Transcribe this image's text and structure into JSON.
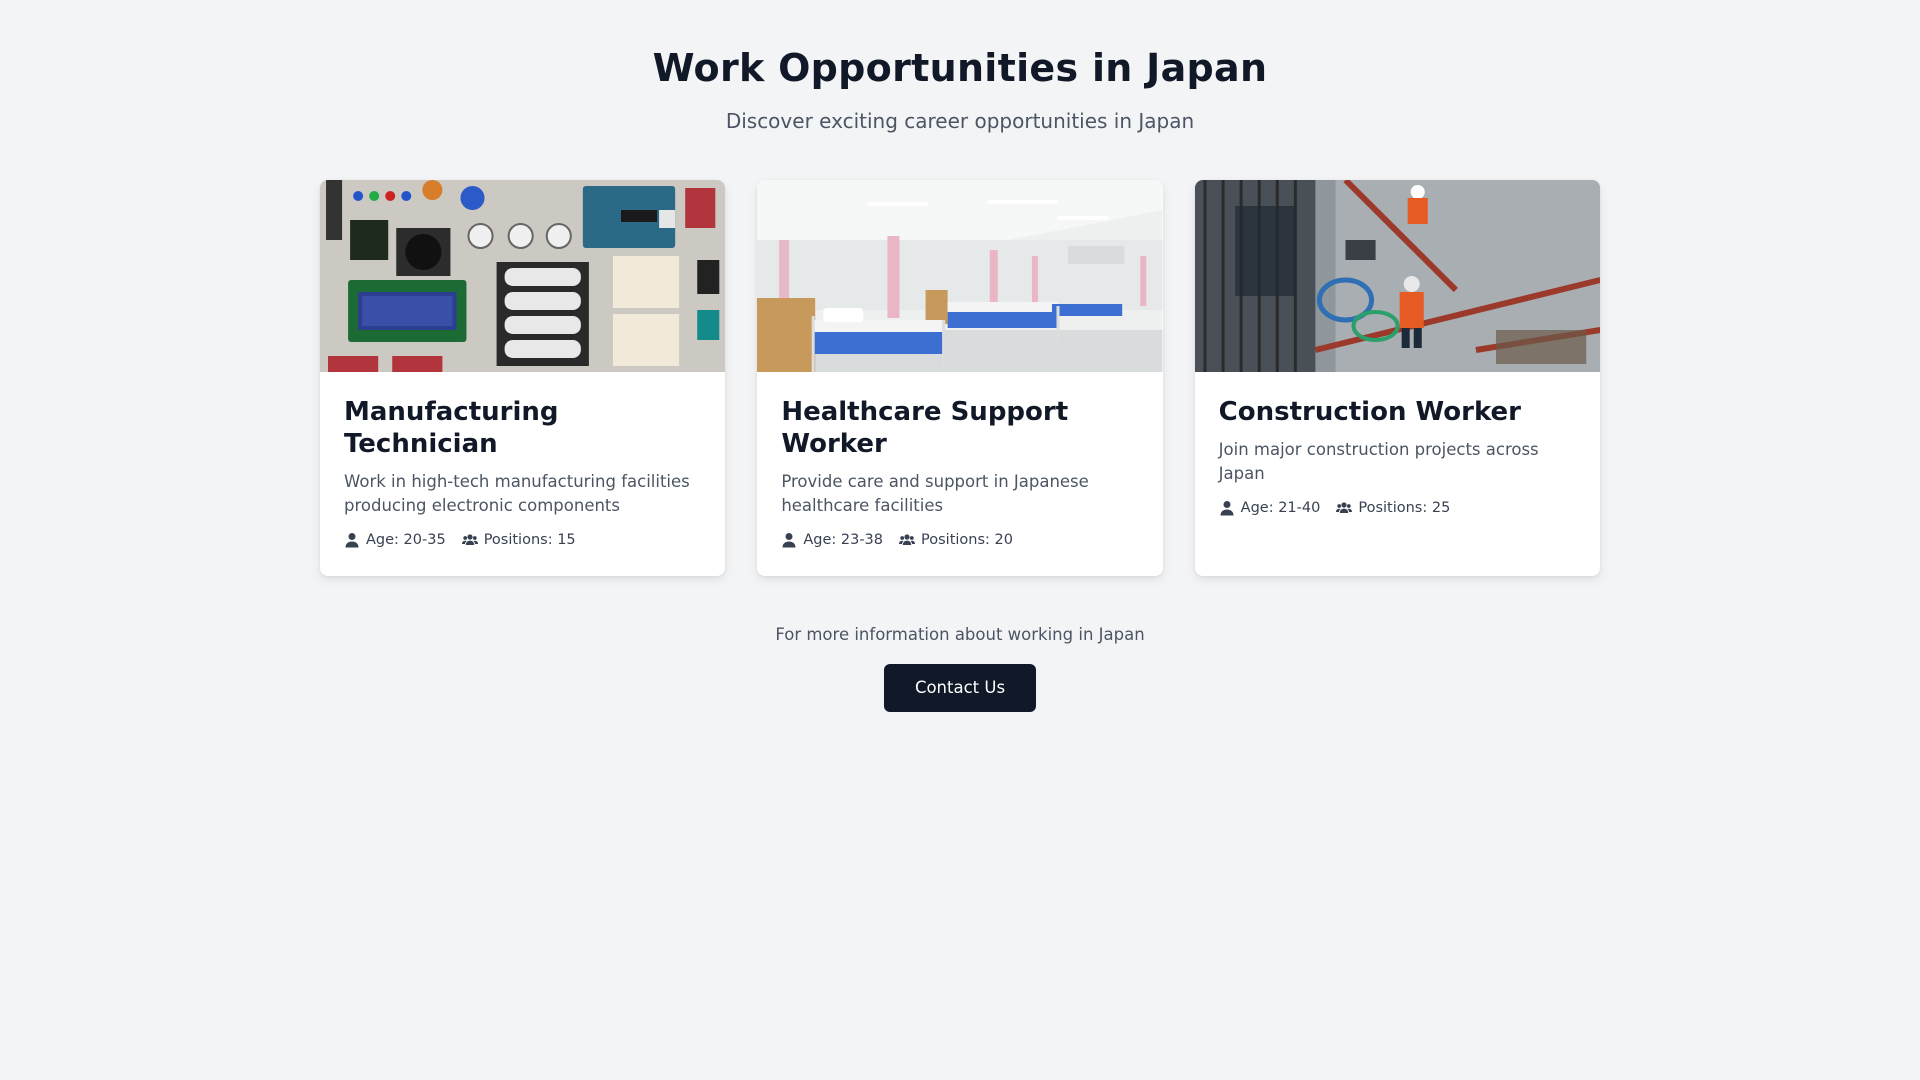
{
  "header": {
    "title": "Work Opportunities in Japan",
    "subtitle": "Discover exciting career opportunities in Japan"
  },
  "jobs": [
    {
      "title": "Manufacturing Technician",
      "description": "Work in high-tech manufacturing facilities producing electronic components",
      "age": "Age: 20-35",
      "positions": "Positions: 15",
      "image": "electronics-components-photo"
    },
    {
      "title": "Healthcare Support Worker",
      "description": "Provide care and support in Japanese healthcare facilities",
      "age": "Age: 23-38",
      "positions": "Positions: 20",
      "image": "hospital-ward-photo"
    },
    {
      "title": "Construction Worker",
      "description": "Join major construction projects across Japan",
      "age": "Age: 21-40",
      "positions": "Positions: 25",
      "image": "construction-site-photo"
    }
  ],
  "footer": {
    "text": "For more information about working in Japan",
    "contact_label": "Contact Us"
  },
  "icons": {
    "age": "user-icon",
    "positions": "users-icon"
  },
  "colors": {
    "background": "#f3f4f6",
    "button": "#111827",
    "card": "#ffffff"
  }
}
